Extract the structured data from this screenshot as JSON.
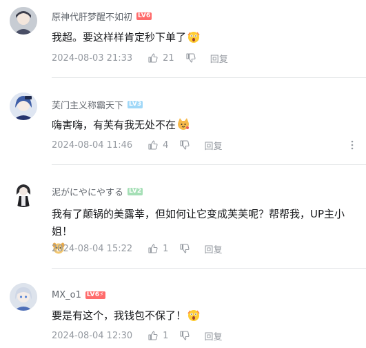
{
  "comments": [
    {
      "username": "原神代肝梦醒不如初",
      "level": "LV6",
      "level_color": "#ff6c6c",
      "text": "我超。要这样样肯定秒下单了",
      "emoji": "shocked-face-emoji",
      "time": "2024-08-03 21:33",
      "likes": "21",
      "reply_label": "回复"
    },
    {
      "username": "芙门主义称霸天下",
      "level": "LV3",
      "level_color": "#a0d8f8",
      "text": "嗨害嗨，有芙有我无处不在",
      "emoji": "cat-face-emoji",
      "time": "2024-08-04 11:46",
      "likes": "4",
      "reply_label": "回复"
    },
    {
      "username": "泥がにやにやする",
      "level": "LV2",
      "level_color": "#a5dfb6",
      "text": "我有了颠锅的美露莘，但如何让它变成芙芙呢？帮帮我，UP主小姐！",
      "emoji": "dog-face-emoji",
      "time": "2024-08-04 15:22",
      "likes": "1",
      "reply_label": "回复"
    },
    {
      "username": "MX_o1",
      "level": "LV6",
      "level_color": "#ff6c6c",
      "text": "要是有这个，我钱包不保了！",
      "emoji": "shocked-face-emoji",
      "time": "2024-08-04 12:30",
      "likes": "1",
      "reply_label": "回复"
    }
  ],
  "icons": {
    "like": "thumbs-up-icon",
    "dislike": "thumbs-down-icon",
    "more": "more-vertical-icon",
    "level_badge_lightning": "lightning-icon"
  }
}
